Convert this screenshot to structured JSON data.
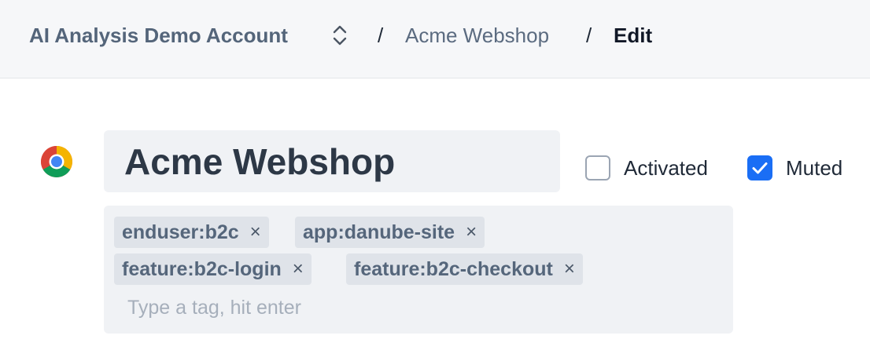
{
  "breadcrumb": {
    "account": "AI Analysis Demo Account",
    "separator": "/",
    "app": "Acme Webshop",
    "current": "Edit"
  },
  "app": {
    "icon": "chrome-icon",
    "name": "Acme Webshop",
    "activated_label": "Activated",
    "activated": false,
    "muted_label": "Muted",
    "muted": true
  },
  "tags": {
    "items": [
      {
        "label": "enduser:b2c"
      },
      {
        "label": "app:danube-site"
      },
      {
        "label": "feature:b2c-login"
      },
      {
        "label": "feature:b2c-checkout"
      }
    ],
    "remove_glyph": "×",
    "placeholder": "Type a tag, hit enter"
  },
  "colors": {
    "accent": "#1a6ef5",
    "tag_bg": "#dfe3e9",
    "field_bg": "#f0f2f5"
  }
}
